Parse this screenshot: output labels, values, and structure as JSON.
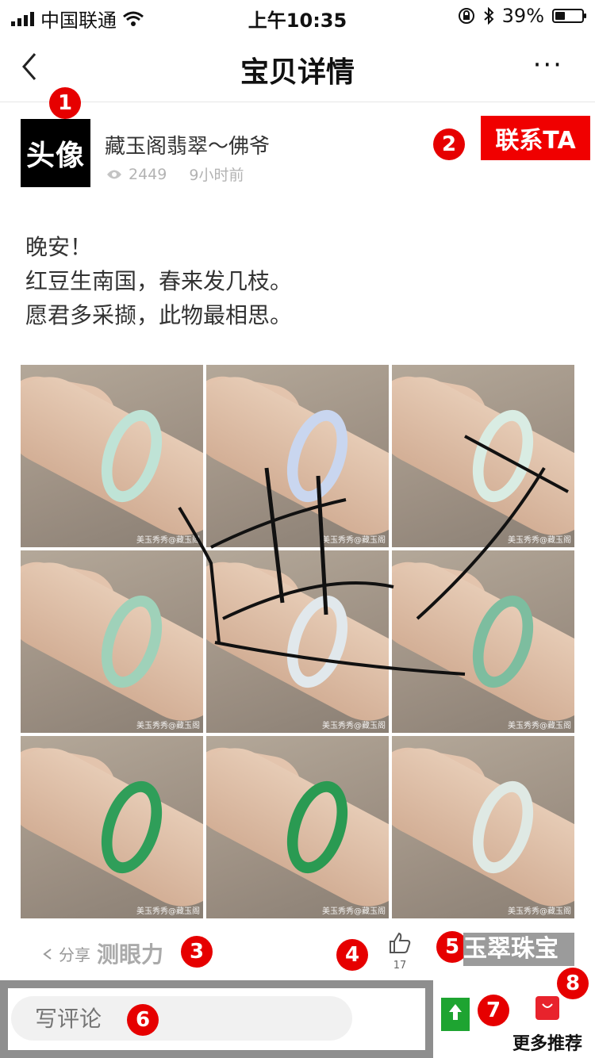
{
  "status_bar": {
    "carrier": "中国联通",
    "time": "上午10:35",
    "battery": "39%"
  },
  "nav": {
    "title": "宝贝详情",
    "more": "···"
  },
  "author": {
    "avatar_text": "头像",
    "name": "藏玉阁翡翠～佛爷",
    "views": "2449",
    "time_ago": "9小时前",
    "contact_label": "联系TA"
  },
  "post": {
    "lines": [
      "晚安！",
      "红豆生南国，春来发几枝。",
      "愿君多采撷，此物最相思。"
    ]
  },
  "photos": {
    "watermark": "美玉秀秀@藏玉阁",
    "bangle_colors": [
      "#bfe3d6",
      "#c9d6ef",
      "#d9ece3",
      "#9fd1b9",
      "#e1e8ec",
      "#7dbd9f",
      "#2f9e59",
      "#2a9a52",
      "#dfe9e4"
    ]
  },
  "actions": {
    "share_label": "分享",
    "eye_test_label": "测眼力",
    "like_count": "17",
    "jade_label": "玉翠珠宝"
  },
  "bottom_bar": {
    "comment_placeholder": "写评论",
    "more_recommend_label": "更多推荐"
  },
  "markers": [
    "1",
    "2",
    "3",
    "4",
    "5",
    "6",
    "7",
    "8"
  ],
  "colors": {
    "contact_bg": "#f00000",
    "marker_red": "#e60000",
    "share_green": "#1ea431",
    "bag_red": "#e8232c"
  }
}
